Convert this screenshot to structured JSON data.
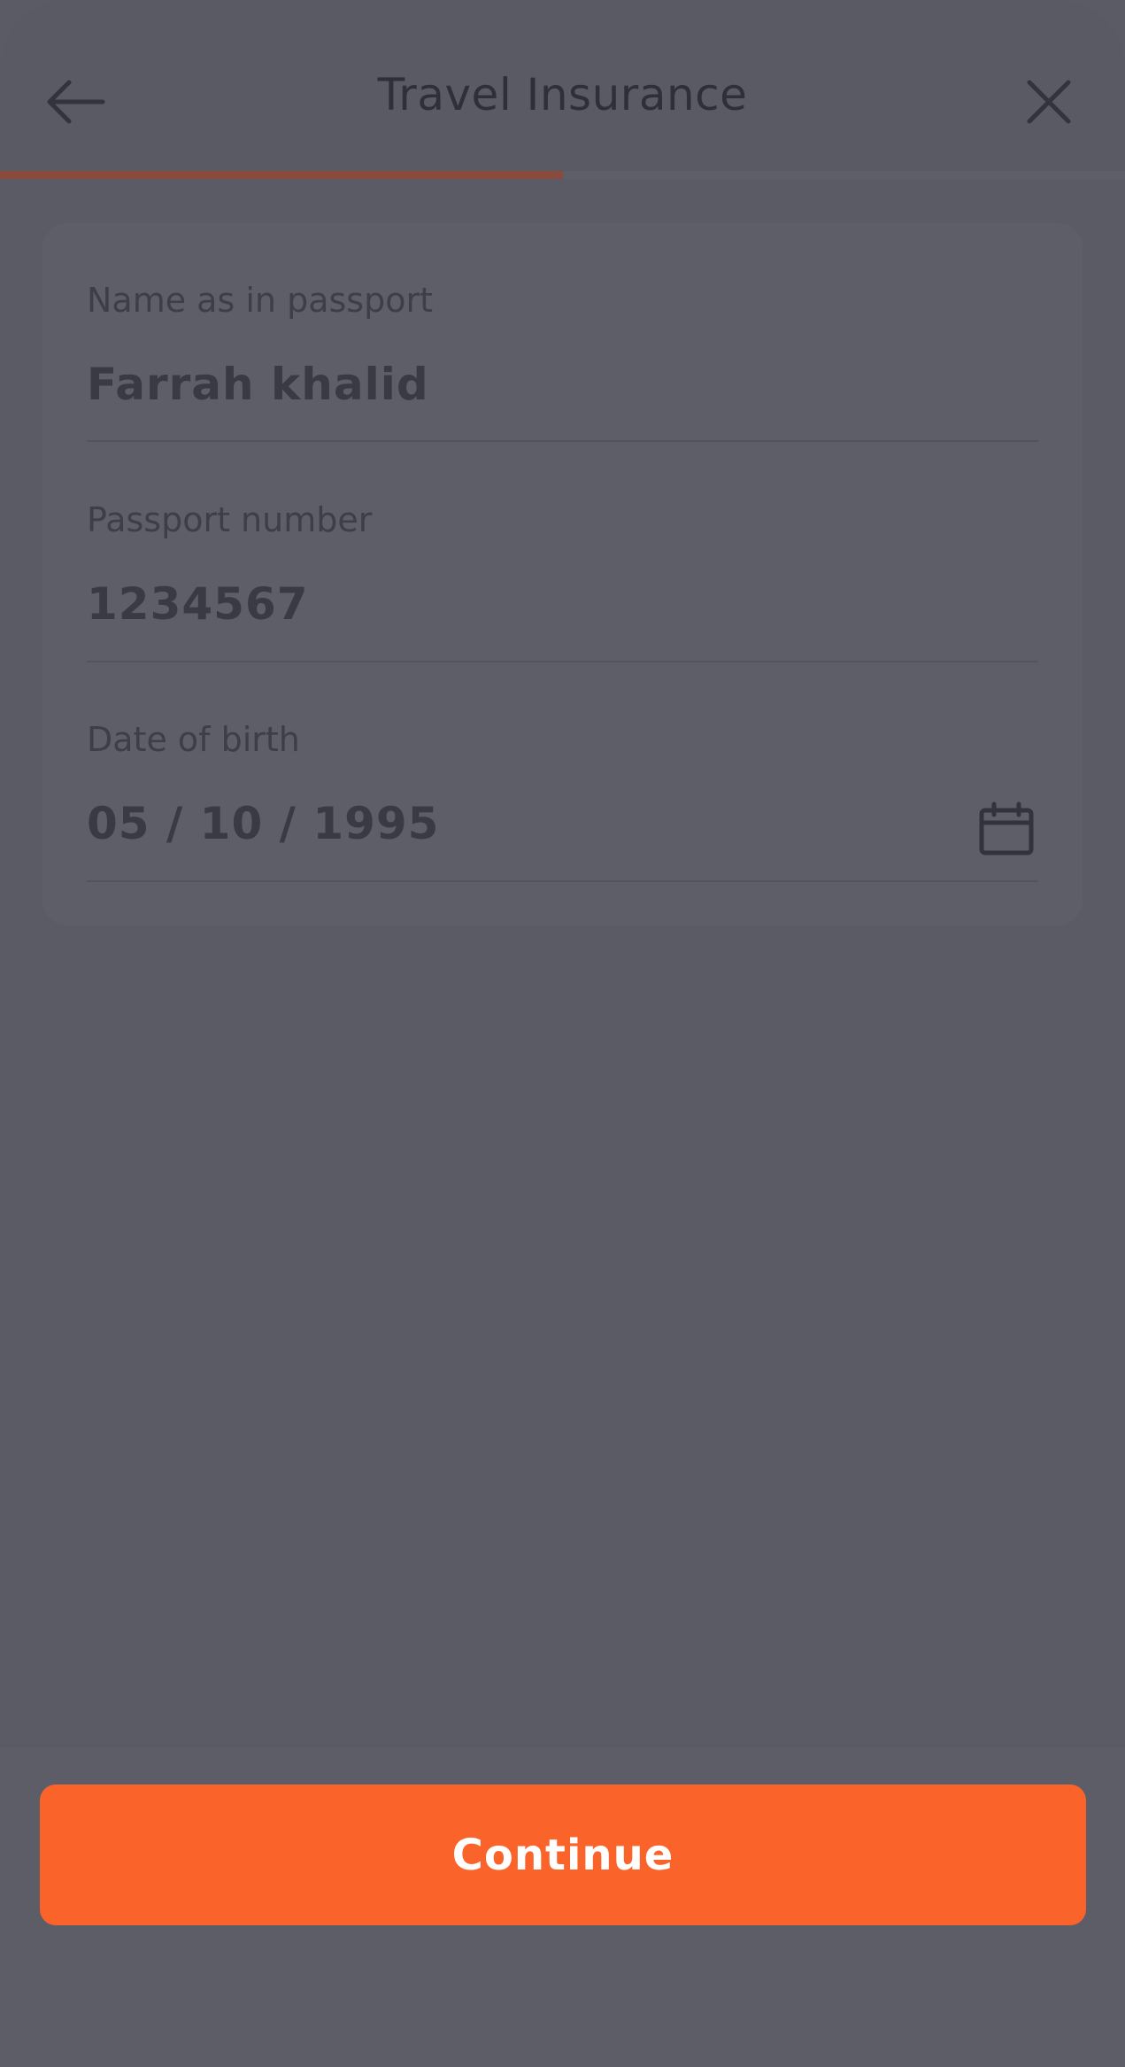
{
  "header": {
    "title": "Travel Insurance",
    "back_icon": "arrow-left-icon",
    "close_icon": "close-icon"
  },
  "progress": {
    "fraction": 0.5,
    "color": "#8a4a3c"
  },
  "form": {
    "name": {
      "label": "Name as in passport",
      "value": "Farrah khalid"
    },
    "passport": {
      "label": "Passport number",
      "value": "1234567"
    },
    "dob": {
      "label": "Date of birth",
      "value": "05 / 10 / 1995",
      "icon": "calendar-icon"
    }
  },
  "footer": {
    "continue_label": "Continue",
    "accent_color": "#fa642a"
  }
}
